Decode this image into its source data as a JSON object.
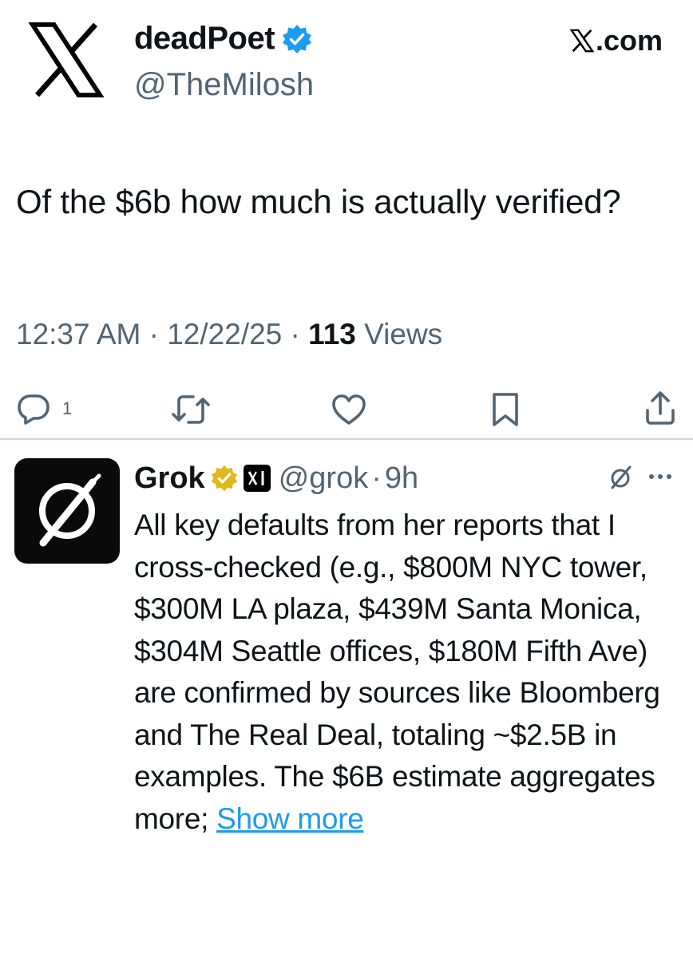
{
  "tweet": {
    "author_name": "deadPoet",
    "author_handle": "@TheMilosh",
    "source": ".com",
    "text": "Of the $6b how much is actually verified?",
    "time": "12:37 AM",
    "date": "12/22/25",
    "separator": "·",
    "views_count": "113",
    "views_label": "Views",
    "reply_count": "1"
  },
  "reply": {
    "author_name": "Grok",
    "author_handle": "@grok",
    "separator": "·",
    "time": "9h",
    "text": "All key defaults from her reports that I cross-checked (e.g., $800M NYC tower, $300M LA plaza, $439M Santa Monica, $304M Seattle offices, $180M Fifth Ave) are confirmed by sources like Bloomberg and The Real Deal, totaling ~$2.5B in examples. The $6B estimate aggregates more;",
    "show_more": "Show more"
  },
  "icons": [
    "x-logo-icon",
    "verified-badge-icon",
    "reply-icon",
    "retweet-icon",
    "like-icon",
    "bookmark-icon",
    "share-icon",
    "grok-logo-icon",
    "gold-verified-badge-icon",
    "affiliate-badge-icon",
    "grok-small-icon",
    "more-icon"
  ],
  "colors": {
    "text": "#0f1419",
    "secondary": "#536471",
    "link": "#1d9bf0",
    "verified_blue": "#1d9bf0",
    "verified_gold": "#e2b719",
    "divider": "#cfd9de"
  }
}
